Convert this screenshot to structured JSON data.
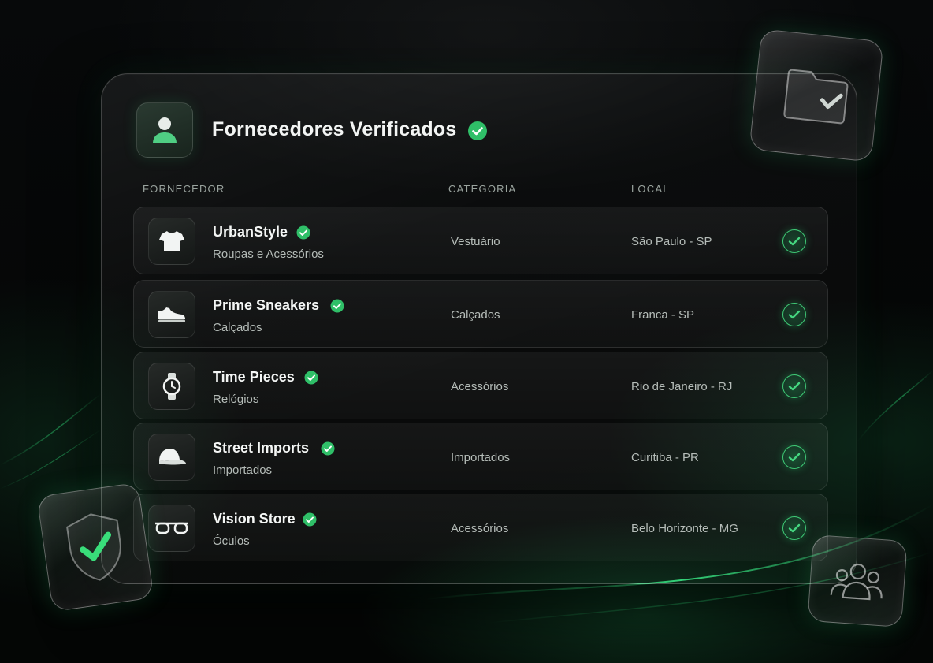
{
  "header": {
    "title": "Fornecedores Verificados"
  },
  "columns": {
    "supplier": "FORNECEDOR",
    "category": "CATEGORIA",
    "location": "LOCAL"
  },
  "suppliers": [
    {
      "name": "UrbanStyle",
      "subtitle": "Roupas e Acessórios",
      "category": "Vestuário",
      "location": "São Paulo - SP",
      "icon": "tshirt-icon"
    },
    {
      "name": "Prime Sneakers",
      "subtitle": "Calçados",
      "category": "Calçados",
      "location": "Franca - SP",
      "icon": "sneaker-icon"
    },
    {
      "name": "Time Pieces",
      "subtitle": "Relógios",
      "category": "Acessórios",
      "location": "Rio de Janeiro - RJ",
      "icon": "watch-icon"
    },
    {
      "name": "Street Imports",
      "subtitle": "Importados",
      "category": "Importados",
      "location": "Curitiba - PR",
      "icon": "cap-icon"
    },
    {
      "name": "Vision Store",
      "subtitle": "Óculos",
      "category": "Acessórios",
      "location": "Belo Horizonte - MG",
      "icon": "glasses-icon"
    }
  ],
  "colors": {
    "accent": "#2fbf68",
    "background": "#060808"
  },
  "decor": {
    "top_right_tile": "folder-check-icon",
    "bottom_left_tile": "shield-check-icon",
    "bottom_right_tile": "users-icon"
  }
}
